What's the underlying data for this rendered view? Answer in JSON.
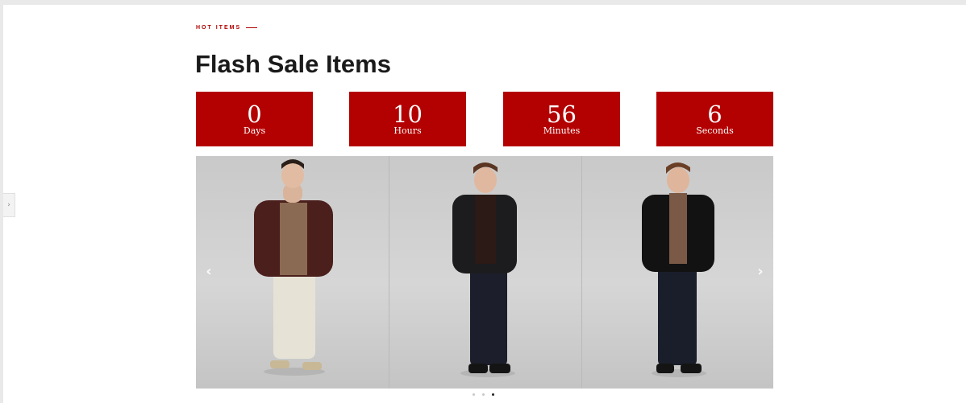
{
  "section": {
    "eyebrow": "HOT ITEMS",
    "title": "Flash Sale Items"
  },
  "countdown": [
    {
      "value": "0",
      "label": "Days"
    },
    {
      "value": "10",
      "label": "Hours"
    },
    {
      "value": "56",
      "label": "Minutes"
    },
    {
      "value": "6",
      "label": "Seconds"
    }
  ],
  "carousel": {
    "prev_icon": "chevron-left-icon",
    "next_icon": "chevron-right-icon",
    "slides": [
      {
        "jacket_color": "#4a1f1c",
        "shirt_color": "#8a6a52",
        "pants_color": "#e6e2d6",
        "shoe_color": "#c8b896"
      },
      {
        "jacket_color": "#1c1c1e",
        "shirt_color": "#2b1a15",
        "pants_color": "#1c1f2b",
        "shoe_color": "#141414"
      },
      {
        "jacket_color": "#121212",
        "shirt_color": "#7a5a47",
        "pants_color": "#1a1d2a",
        "shoe_color": "#141414"
      }
    ],
    "dots_total": 3,
    "dots_active_index": 2
  },
  "colors": {
    "accent": "#b30000",
    "title": "#1a1a1a"
  }
}
